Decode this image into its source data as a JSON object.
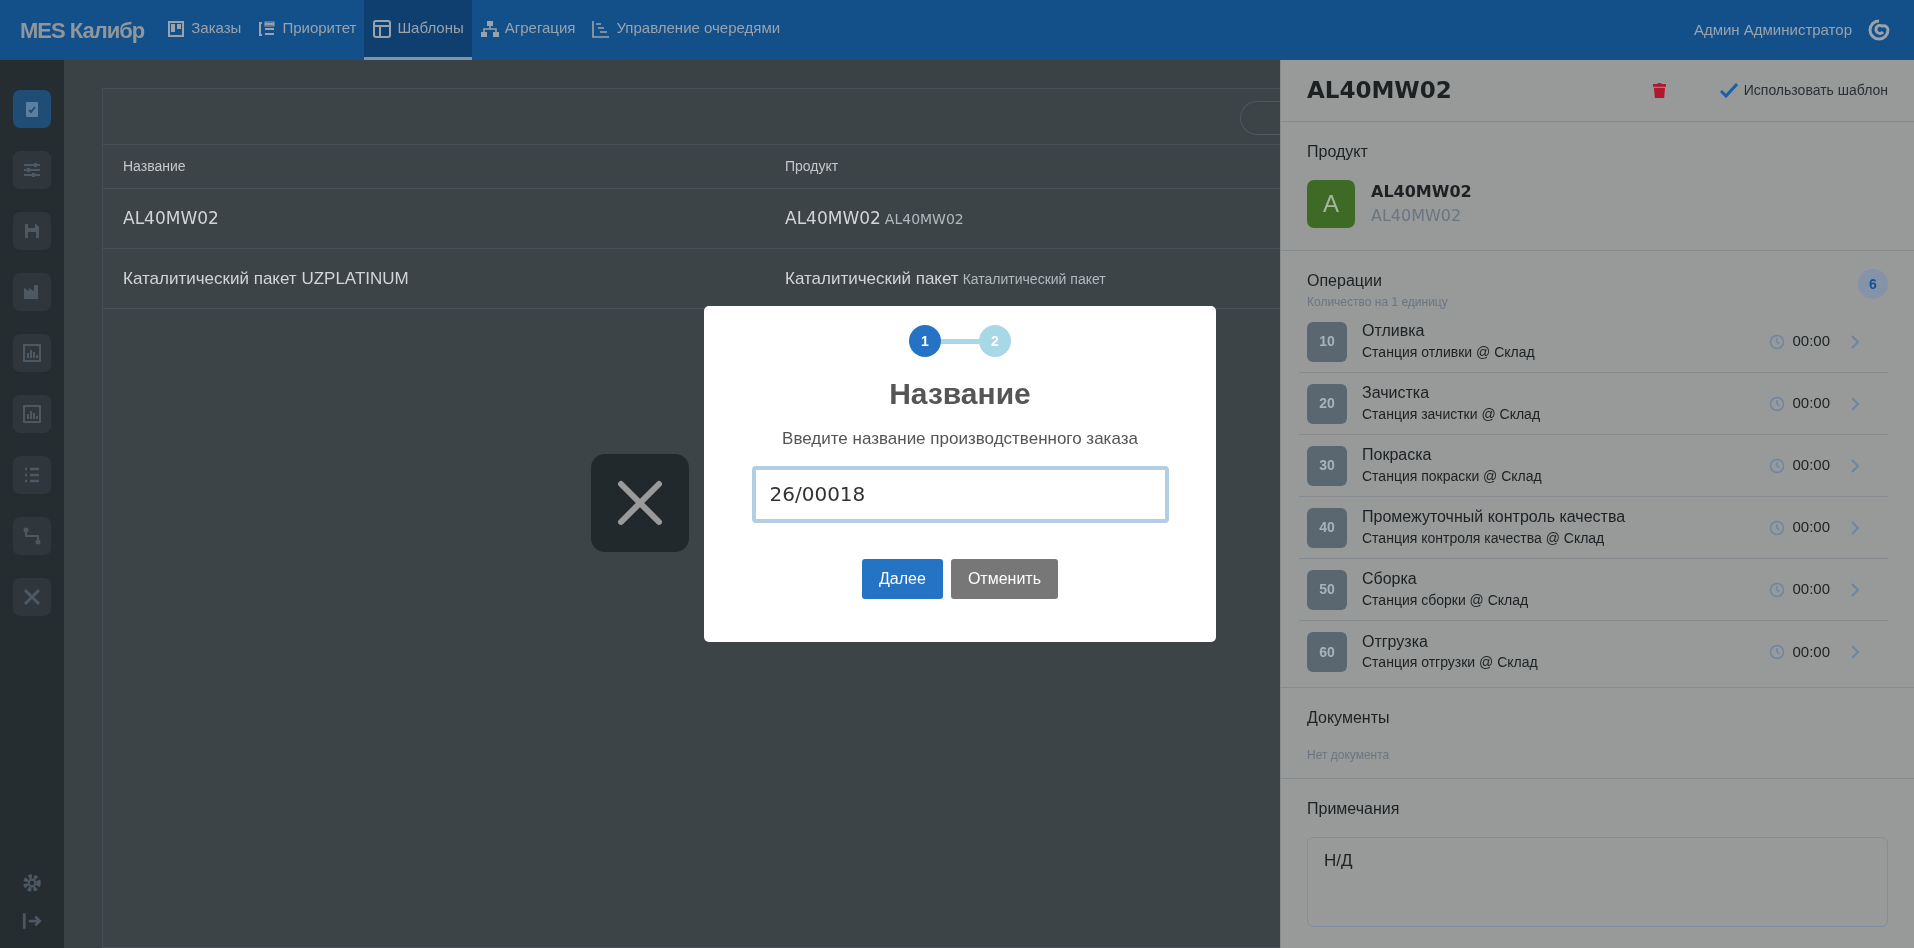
{
  "navbar": {
    "brand": "MES Калибр",
    "items": [
      {
        "label": "Заказы",
        "selected": false
      },
      {
        "label": "Приоритет",
        "selected": false
      },
      {
        "label": "Шаблоны",
        "selected": true
      },
      {
        "label": "Агрегация",
        "selected": false
      },
      {
        "label": "Управление очередями",
        "selected": false
      }
    ],
    "user": "Админ Администратор"
  },
  "sidebar": {
    "items": [
      {
        "selected": true
      },
      {
        "selected": false
      },
      {
        "selected": false
      },
      {
        "selected": false
      },
      {
        "selected": false
      },
      {
        "selected": false
      },
      {
        "selected": false
      },
      {
        "selected": false
      },
      {
        "selected": false
      }
    ]
  },
  "table": {
    "columns": [
      "Название",
      "Продукт"
    ],
    "rows": [
      {
        "name": "AL40MW02",
        "product": "AL40MW02",
        "product_code": "AL40MW02"
      },
      {
        "name": "Каталитический пакет UZPLATINUM",
        "product": "Каталитический пакет",
        "product_code": "Каталитический пакет"
      }
    ]
  },
  "panel": {
    "title": "AL40MW02",
    "use_template": "Использовать шаблон",
    "product": {
      "heading": "Продукт",
      "avatar": "A",
      "name": "AL40MW02",
      "code": "AL40MW02"
    },
    "operations": {
      "heading": "Операции",
      "subtitle": "Количество на 1 единицу",
      "count": "6",
      "items": [
        {
          "number": "10",
          "name": "Отливка",
          "station": "Станция отливки @ Склад",
          "time": "00:00"
        },
        {
          "number": "20",
          "name": "Зачистка",
          "station": "Станция зачистки @ Склад",
          "time": "00:00"
        },
        {
          "number": "30",
          "name": "Покраска",
          "station": "Станция покраски @ Склад",
          "time": "00:00"
        },
        {
          "number": "40",
          "name": "Промежуточный контроль качества",
          "station": "Станция контроля качества @ Склад",
          "time": "00:00"
        },
        {
          "number": "50",
          "name": "Сборка",
          "station": "Станция сборки @ Склад",
          "time": "00:00"
        },
        {
          "number": "60",
          "name": "Отгрузка",
          "station": "Станция отгрузки @ Склад",
          "time": "00:00"
        }
      ]
    },
    "documents": {
      "heading": "Документы",
      "empty": "Нет документа"
    },
    "notes": {
      "heading": "Примечания",
      "value": "Н/Д"
    }
  },
  "modal": {
    "steps": [
      {
        "label": "1",
        "selected": true
      },
      {
        "label": "2",
        "selected": false
      }
    ],
    "title": "Название",
    "prompt": "Введите название производственного заказа",
    "value": "26/00018",
    "buttons": [
      {
        "label": "Далее",
        "kind": "primary"
      },
      {
        "label": "Отменить",
        "kind": "secondary"
      }
    ]
  }
}
